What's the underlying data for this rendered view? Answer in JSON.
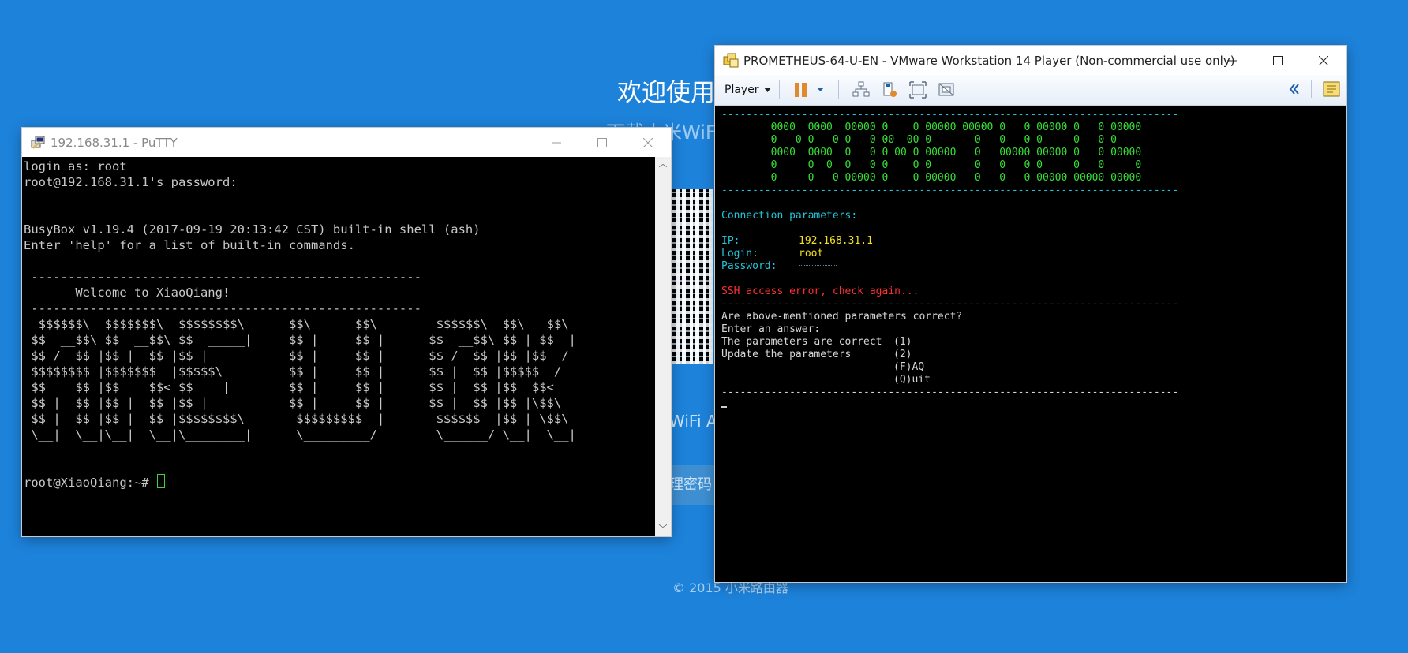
{
  "background": {
    "welcome": "欢迎使用",
    "download": "下载小米WiFi",
    "app": "WiFi A",
    "button": "理密码",
    "footer": "© 2015 小米路由器"
  },
  "putty": {
    "title": "192.168.31.1 - PuTTY",
    "lines": [
      "login as: root",
      "root@192.168.31.1's password:",
      "",
      "",
      "BusyBox v1.19.4 (2017-09-19 20:13:42 CST) built-in shell (ash)",
      "Enter 'help' for a list of built-in commands.",
      "",
      " -----------------------------------------------------",
      "       Welcome to XiaoQiang!",
      " -----------------------------------------------------",
      "  $$$$$$\\  $$$$$$$\\  $$$$$$$$\\      $$\\      $$\\        $$$$$$\\  $$\\   $$\\",
      " $$  __$$\\ $$  __$$\\ $$  _____|     $$ |     $$ |      $$  __$$\\ $$ | $$  |",
      " $$ /  $$ |$$ |  $$ |$$ |           $$ |     $$ |      $$ /  $$ |$$ |$$  /",
      " $$$$$$$$ |$$$$$$$  |$$$$$\\         $$ |     $$ |      $$ |  $$ |$$$$$  /",
      " $$  __$$ |$$  __$$< $$  __|        $$ |     $$ |      $$ |  $$ |$$  $$<",
      " $$ |  $$ |$$ |  $$ |$$ |           $$ |     $$ |      $$ |  $$ |$$ |\\$$\\",
      " $$ |  $$ |$$ |  $$ |$$$$$$$$\\       $$$$$$$$$  |       $$$$$$  |$$ | \\$$\\",
      " \\__|  \\__|\\__|  \\__|\\________|      \\_________/        \\______/ \\__|  \\__|",
      "",
      ""
    ],
    "prompt": "root@XiaoQiang:~# "
  },
  "vmware": {
    "title": "PROMETHEUS-64-U-EN - VMware Workstation 14 Player (Non-commercial use only)",
    "player_menu": "Player",
    "divider": "--------------------------------------------------------------------------",
    "banner": [
      "        0000  0000  00000 0    0 00000 00000 0   0 00000 0   0 00000",
      "        0   0 0   0 0   0 00  00 0       0   0   0 0     0   0 0",
      "        0000  0000  0   0 0 00 0 00000   0   00000 00000 0   0 00000",
      "        0     0  0  0   0 0    0 0       0   0   0 0     0   0     0",
      "        0     0   0 00000 0    0 00000   0   0   0 00000 00000 00000"
    ],
    "conn_header": "Connection parameters:",
    "ip_label": "IP:",
    "ip_value": "192.168.31.1",
    "login_label": "Login:",
    "login_value": "root",
    "password_label": "Password:",
    "ssh_error": "SSH access error, check again...",
    "question": "Are above-mentioned parameters correct?",
    "enter_answer": "Enter an answer:",
    "opt1_label": "The parameters are correct",
    "opt1_key": "(1)",
    "opt2_label": "Update the parameters",
    "opt2_key": "(2)",
    "opt3_key": "(F)AQ",
    "opt4_key": "(Q)uit"
  }
}
